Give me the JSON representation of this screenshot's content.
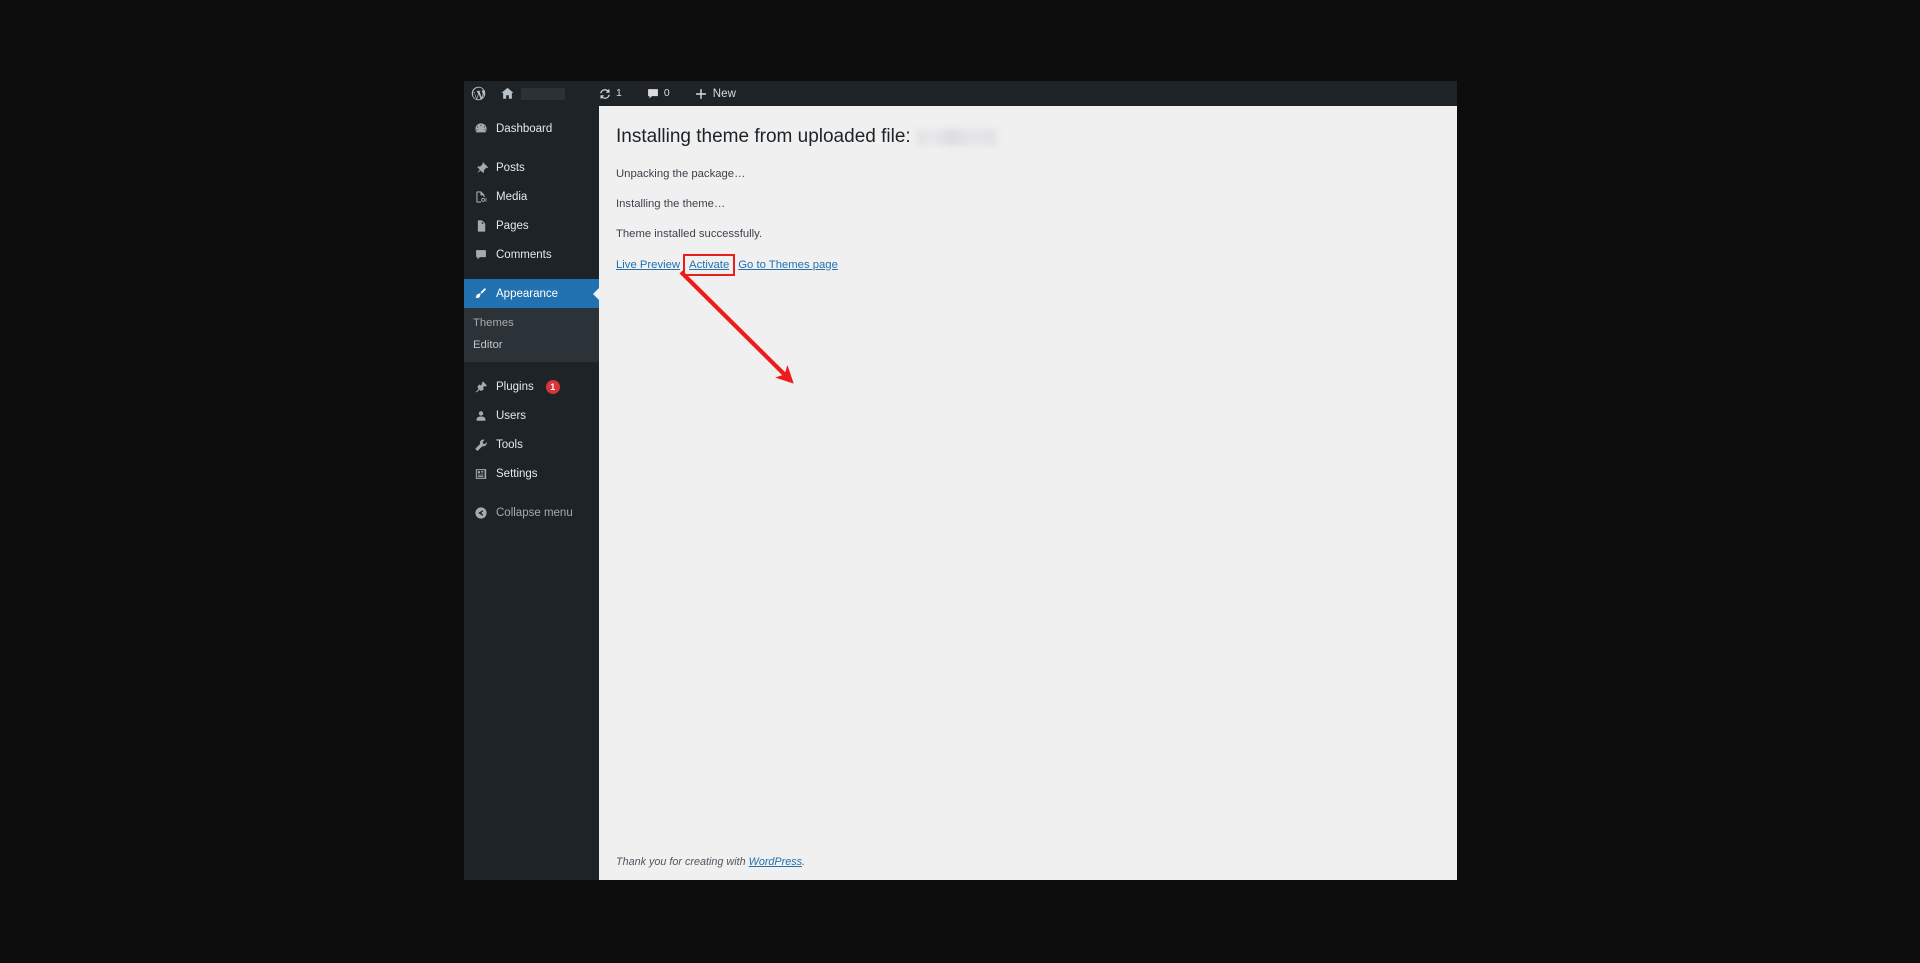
{
  "adminbar": {
    "wp_logo_icon": "wordpress-logo-icon",
    "home_icon": "home-icon",
    "site_name_redacted": "",
    "updates_icon": "updates-icon",
    "updates_count": "1",
    "comments_icon": "comment-bubble-icon",
    "comments_count": "0",
    "new_icon": "plus-icon",
    "new_label": "New"
  },
  "sidebar": {
    "items": [
      {
        "label": "Dashboard",
        "icon": "dashboard-icon",
        "key": "dashboard"
      },
      {
        "label": "Posts",
        "icon": "pin-icon",
        "key": "posts"
      },
      {
        "label": "Media",
        "icon": "media-icon",
        "key": "media"
      },
      {
        "label": "Pages",
        "icon": "page-icon",
        "key": "pages"
      },
      {
        "label": "Comments",
        "icon": "comment-bubble-icon",
        "key": "comments"
      },
      {
        "label": "Appearance",
        "icon": "paintbrush-icon",
        "key": "appearance",
        "current": true
      },
      {
        "label": "Plugins",
        "icon": "plug-icon",
        "key": "plugins",
        "badge": "1"
      },
      {
        "label": "Users",
        "icon": "user-icon",
        "key": "users"
      },
      {
        "label": "Tools",
        "icon": "wrench-icon",
        "key": "tools"
      },
      {
        "label": "Settings",
        "icon": "settings-sliders-icon",
        "key": "settings"
      }
    ],
    "submenu": [
      {
        "label": "Themes",
        "key": "themes"
      },
      {
        "label": "Editor",
        "key": "editor"
      }
    ],
    "collapse": {
      "label": "Collapse menu",
      "icon": "collapse-arrow-icon"
    }
  },
  "main": {
    "title_prefix": "Installing theme from uploaded file:",
    "title_filename_redacted": "",
    "status_lines": [
      "Unpacking the package…",
      "Installing the theme…",
      "Theme installed successfully."
    ],
    "links": {
      "live_preview": "Live Preview",
      "activate": "Activate",
      "go_to_themes": "Go to Themes page"
    }
  },
  "footer": {
    "text_before": "Thank you for creating with ",
    "link": "WordPress",
    "text_after": "."
  },
  "annotation": {
    "highlight_color": "#e8201c",
    "arrow_color": "#ee1b1b",
    "target": "activate-link"
  },
  "colors": {
    "admin_dark": "#1d2327",
    "submenu_dark": "#2c3338",
    "accent_blue": "#2271b1",
    "content_bg": "#f0f0f1",
    "badge_red": "#d63638",
    "page_bg": "#0d0d0d"
  }
}
